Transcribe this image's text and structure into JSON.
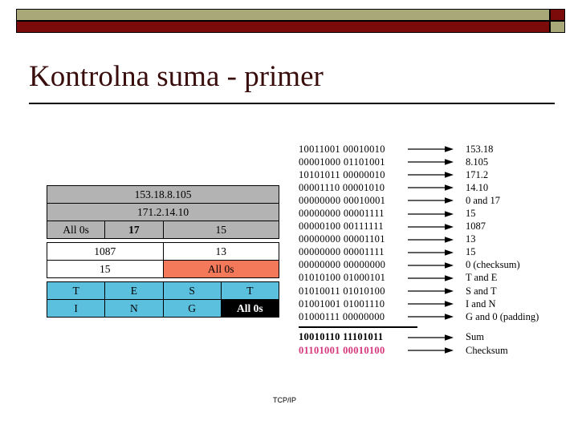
{
  "slide": {
    "title": "Kontrolna suma - primer",
    "footer": "TCP/IP"
  },
  "theme": {
    "banner_khaki": "#a8a878",
    "banner_maroon": "#7b0a0a",
    "title_color": "#3a0d0d",
    "gray_row": "#b3b3b3",
    "cyan_row": "#5bc0de",
    "salmon_cell": "#f4795b",
    "checksum_pink": "#d6387e"
  },
  "packet_table": {
    "blocks": [
      {
        "name": "header-gray",
        "rows": [
          {
            "cells": [
              {
                "text": "153.18.8.105",
                "span": 4,
                "style": "plain"
              }
            ]
          },
          {
            "cells": [
              {
                "text": "171.2.14.10",
                "span": 4,
                "style": "plain"
              }
            ]
          },
          {
            "cells": [
              {
                "text": "All 0s",
                "span": 1,
                "style": "plain"
              },
              {
                "text": "17",
                "span": 1,
                "style": "bold"
              },
              {
                "text": "15",
                "span": 2,
                "style": "plain"
              }
            ]
          }
        ]
      },
      {
        "name": "udp-white",
        "rows": [
          {
            "cells": [
              {
                "text": "1087",
                "span": 2,
                "style": "plain"
              },
              {
                "text": "13",
                "span": 2,
                "style": "plain"
              }
            ]
          },
          {
            "cells": [
              {
                "text": "15",
                "span": 2,
                "style": "plain"
              },
              {
                "text": "All 0s",
                "span": 2,
                "style": "salmon"
              }
            ]
          }
        ]
      },
      {
        "name": "data-cyan",
        "rows": [
          {
            "cells": [
              {
                "text": "T",
                "span": 1,
                "style": "plain"
              },
              {
                "text": "E",
                "span": 1,
                "style": "plain"
              },
              {
                "text": "S",
                "span": 1,
                "style": "plain"
              },
              {
                "text": "T",
                "span": 1,
                "style": "plain"
              }
            ]
          },
          {
            "cells": [
              {
                "text": "I",
                "span": 1,
                "style": "plain"
              },
              {
                "text": "N",
                "span": 1,
                "style": "plain"
              },
              {
                "text": "G",
                "span": 1,
                "style": "plain"
              },
              {
                "text": "All 0s",
                "span": 1,
                "style": "blackcell"
              }
            ]
          }
        ]
      }
    ]
  },
  "calculation": {
    "rows": [
      {
        "bits": "10011001  00010010",
        "meaning": "153.18"
      },
      {
        "bits": "00001000  01101001",
        "meaning": "8.105"
      },
      {
        "bits": "10101011  00000010",
        "meaning": "171.2"
      },
      {
        "bits": "00001110  00001010",
        "meaning": "14.10"
      },
      {
        "bits": "00000000  00010001",
        "meaning": "0 and 17"
      },
      {
        "bits": "00000000  00001111",
        "meaning": "15"
      },
      {
        "bits": "00000100  00111111",
        "meaning": "1087"
      },
      {
        "bits": "00000000  00001101",
        "meaning": "13"
      },
      {
        "bits": "00000000  00001111",
        "meaning": "15"
      },
      {
        "bits": "00000000  00000000",
        "meaning": "0 (checksum)"
      },
      {
        "bits": "01010100  01000101",
        "meaning": "T and E"
      },
      {
        "bits": "01010011  01010100",
        "meaning": "S and T"
      },
      {
        "bits": "01001001  01001110",
        "meaning": "I and N"
      },
      {
        "bits": "01000111  00000000",
        "meaning": "G and 0 (padding)"
      }
    ],
    "result_rows": [
      {
        "bits": "10010110  11101011",
        "meaning": "Sum",
        "kind": "sum"
      },
      {
        "bits": "01101001  00010100",
        "meaning": "Checksum",
        "kind": "checksum"
      }
    ]
  }
}
